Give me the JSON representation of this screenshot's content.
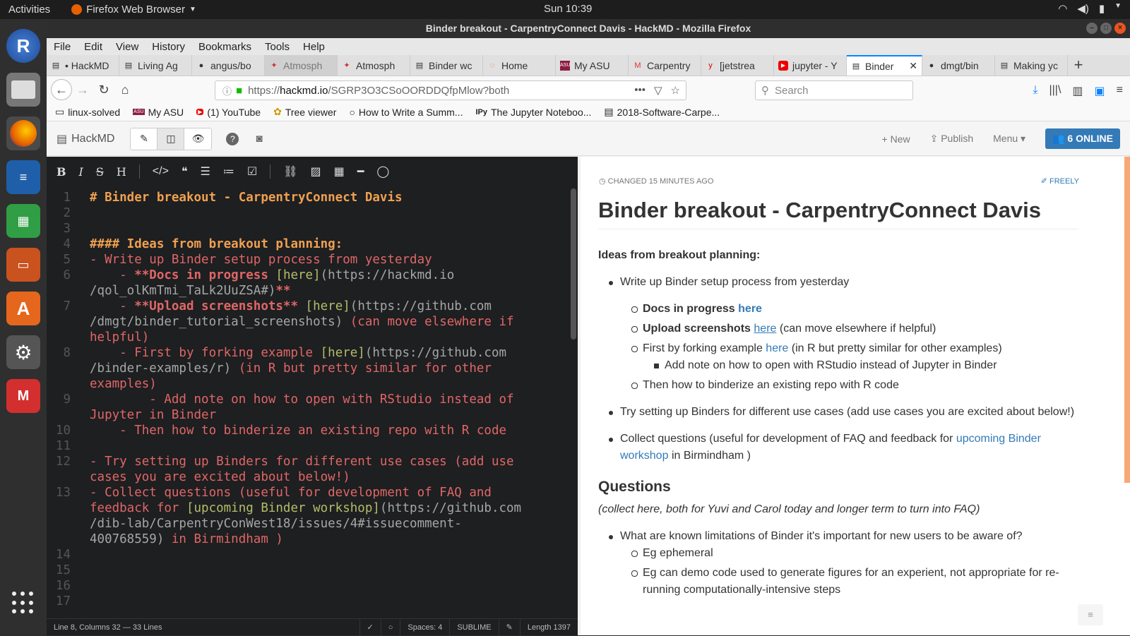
{
  "topbar": {
    "activities": "Activities",
    "app_name": "Firefox Web Browser",
    "clock": "Sun 10:39"
  },
  "window": {
    "title": "Binder breakout - CarpentryConnect Davis - HackMD - Mozilla Firefox"
  },
  "menu": [
    "File",
    "Edit",
    "View",
    "History",
    "Bookmarks",
    "Tools",
    "Help"
  ],
  "tabs": [
    {
      "label": "• HackMD",
      "icon": "hackmd-icon"
    },
    {
      "label": "Living Ag",
      "icon": "page-icon"
    },
    {
      "label": "angus/bo",
      "icon": "github-icon"
    },
    {
      "label": "Atmosph",
      "icon": "atmosphere-icon"
    },
    {
      "label": "Atmosph",
      "icon": "atmosphere-icon"
    },
    {
      "label": "Binder wc",
      "icon": "page-icon"
    },
    {
      "label": "Home",
      "icon": "jupyter-icon"
    },
    {
      "label": "My ASU",
      "icon": "asu-icon"
    },
    {
      "label": "Carpentry",
      "icon": "gmail-icon"
    },
    {
      "label": "[jetstrea",
      "icon": "yahoo-icon"
    },
    {
      "label": "jupyter - Y",
      "icon": "youtube-icon"
    },
    {
      "label": "Binder",
      "icon": "page-icon",
      "selected": true
    },
    {
      "label": "dmgt/bin",
      "icon": "github-icon"
    },
    {
      "label": "Making yc",
      "icon": "page-icon"
    }
  ],
  "url": {
    "prefix": "https://",
    "host": "hackmd.io",
    "path": "/SGRP3O3CSoOORDDQfpMlow?both"
  },
  "search": {
    "placeholder": "Search"
  },
  "bookmarks": [
    "linux-solved",
    "My ASU",
    "(1) YouTube",
    "Tree viewer",
    "How to Write a Summ...",
    "The Jupyter Noteboo...",
    "2018-Software-Carpe..."
  ],
  "hackmd": {
    "brand": "HackMD",
    "new_label": "New",
    "publish_label": "Publish",
    "menu_label": "Menu",
    "online_label": "6 ONLINE"
  },
  "editor_lines": [
    {
      "n": "1",
      "segs": [
        {
          "c": "c-h",
          "t": "# Binder breakout - CarpentryConnect Davis"
        }
      ]
    },
    {
      "n": "2",
      "segs": []
    },
    {
      "n": "3",
      "segs": []
    },
    {
      "n": "4",
      "segs": [
        {
          "c": "c-h",
          "t": "#### Ideas from breakout planning:"
        }
      ]
    },
    {
      "n": "5",
      "segs": [
        {
          "c": "c-red",
          "t": "- Write up Binder setup process from yesterday"
        }
      ]
    },
    {
      "n": "6",
      "segs": [
        {
          "c": "c-red",
          "t": "    - "
        },
        {
          "c": "c-bold",
          "t": "**Docs in progress "
        },
        {
          "c": "c-link",
          "t": "[here]"
        },
        {
          "c": "c-grey",
          "t": "(https://hackmd.io"
        }
      ]
    },
    {
      "n": "",
      "segs": [
        {
          "c": "c-grey",
          "t": "/qol_olKmTmi_TaLk2UuZSA#)"
        },
        {
          "c": "c-bold",
          "t": "**"
        }
      ]
    },
    {
      "n": "7",
      "segs": [
        {
          "c": "c-red",
          "t": "    - "
        },
        {
          "c": "c-bold",
          "t": "**Upload screenshots**"
        },
        {
          "c": "c-link",
          "t": " [here]"
        },
        {
          "c": "c-grey",
          "t": "(https://github.com"
        }
      ]
    },
    {
      "n": "",
      "segs": [
        {
          "c": "c-grey",
          "t": "/dmgt/binder_tutorial_screenshots)"
        },
        {
          "c": "c-red",
          "t": " (can move elsewhere if"
        }
      ]
    },
    {
      "n": "",
      "segs": [
        {
          "c": "c-red",
          "t": "helpful)"
        }
      ]
    },
    {
      "n": "8",
      "segs": [
        {
          "c": "c-red",
          "t": "    - First by forking example "
        },
        {
          "c": "c-link",
          "t": "[here]"
        },
        {
          "c": "c-grey",
          "t": "(https://github.com"
        }
      ]
    },
    {
      "n": "",
      "segs": [
        {
          "c": "c-grey",
          "t": "/binder-examples/r)"
        },
        {
          "c": "c-red",
          "t": " (in R but pretty similar for other"
        }
      ]
    },
    {
      "n": "",
      "segs": [
        {
          "c": "c-red",
          "t": "examples)"
        }
      ]
    },
    {
      "n": "9",
      "segs": [
        {
          "c": "c-red",
          "t": "        - Add note on how to open with RStudio instead of"
        }
      ]
    },
    {
      "n": "",
      "segs": [
        {
          "c": "c-red",
          "t": "Jupyter in Binder"
        }
      ]
    },
    {
      "n": "10",
      "segs": [
        {
          "c": "c-red",
          "t": "    - Then how to binderize an existing repo with R code"
        }
      ]
    },
    {
      "n": "11",
      "segs": []
    },
    {
      "n": "12",
      "segs": [
        {
          "c": "c-red",
          "t": "- Try setting up Binders for different use cases (add use"
        }
      ]
    },
    {
      "n": "",
      "segs": [
        {
          "c": "c-red",
          "t": "cases you are excited about below!)"
        }
      ]
    },
    {
      "n": "13",
      "segs": [
        {
          "c": "c-red",
          "t": "- Collect questions (useful for development of FAQ and"
        }
      ]
    },
    {
      "n": "",
      "segs": [
        {
          "c": "c-red",
          "t": "feedback for "
        },
        {
          "c": "c-link",
          "t": "[upcoming Binder workshop]"
        },
        {
          "c": "c-grey",
          "t": "(https://github.com"
        }
      ]
    },
    {
      "n": "",
      "segs": [
        {
          "c": "c-grey",
          "t": "/dib-lab/CarpentryConWest18/issues/4#issuecomment-"
        }
      ]
    },
    {
      "n": "",
      "segs": [
        {
          "c": "c-grey",
          "t": "400768559)"
        },
        {
          "c": "c-red",
          "t": " in Birmindham )"
        }
      ]
    },
    {
      "n": "14",
      "segs": []
    },
    {
      "n": "15",
      "segs": []
    },
    {
      "n": "16",
      "segs": []
    },
    {
      "n": "17",
      "segs": []
    }
  ],
  "status": {
    "cursor": "Line 8, Columns 32 — 33 Lines",
    "spaces": "Spaces: 4",
    "keymap": "SUBLIME",
    "length": "Length 1397"
  },
  "preview": {
    "changed": "CHANGED 15 MINUTES AGO",
    "freely": "FREELY",
    "title": "Binder breakout - CarpentryConnect Davis",
    "ideas_heading": "Ideas from breakout planning:",
    "item1": "Write up Binder setup process from yesterday",
    "docs_bold": "Docs in progress",
    "docs_link": "here",
    "upload_bold": "Upload screenshots",
    "upload_link": "here",
    "upload_rest": "(can move elsewhere if helpful)",
    "fork_text": "First by forking example",
    "fork_link": "here",
    "fork_rest": "(in R but pretty similar for other examples)",
    "rstudio": "Add note on how to open with RStudio instead of Jupyter in Binder",
    "binderize": "Then how to binderize an existing repo with R code",
    "try": "Try setting up Binders for different use cases (add use cases you are excited about below!)",
    "collect_pre": "Collect questions (useful for development of FAQ and feedback for",
    "collect_link": "upcoming Binder workshop",
    "collect_post": "in Birmindham )",
    "questions_heading": "Questions",
    "questions_note": "(collect here, both for Yuvi and Carol today and longer term to turn into FAQ)",
    "q1": "What are known limitations of Binder it's important for new users to be aware of?",
    "q1a": "Eg ephemeral",
    "q1b": "Eg can demo code used to generate figures for an experient, not appropriate for re-running computationally-intensive steps"
  }
}
